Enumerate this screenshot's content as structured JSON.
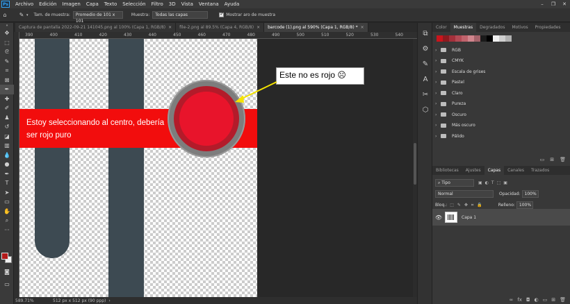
{
  "menubar": {
    "logo": "Ps",
    "items": [
      "Archivo",
      "Edición",
      "Imagen",
      "Capa",
      "Texto",
      "Selección",
      "Filtro",
      "3D",
      "Vista",
      "Ventana",
      "Ayuda"
    ],
    "window_controls": [
      "–",
      "❐",
      "✕"
    ]
  },
  "options_bar": {
    "sample_size_label": "Tam. de muestra:",
    "sample_size_value": "Promedio de 101 x 101",
    "sample_label": "Muestra:",
    "sample_value": "Todas las capas",
    "show_ring_label": "Mostrar aro de muestra"
  },
  "doc_tabs": [
    {
      "label": "Captura de pantalla 2022-09-21 141045.png al 100% (Capa 1, RGB/8)",
      "active": false
    },
    {
      "label": "file-2.png al 89.5% (Capa 4, RGB/8)",
      "active": false
    },
    {
      "label": "barcode (1).png al 590% (Capa 1, RGB/8) *",
      "active": true
    }
  ],
  "ruler": {
    "ticks": [
      "390",
      "400",
      "410",
      "420",
      "430",
      "440",
      "450",
      "460",
      "470",
      "480",
      "490",
      "500",
      "510",
      "520",
      "530",
      "540"
    ]
  },
  "canvas": {
    "annotation_callout": "Este no es rojo ☹",
    "annotation_banner": "Estoy seleccionando al centro, debería ser rojo puro"
  },
  "status": {
    "zoom": "589.71%",
    "doc_info": "512 px x 512 px (90 ppp)"
  },
  "panels": {
    "top_tabs": [
      "Color",
      "Muestras",
      "Degradados",
      "Motivos",
      "Propiedades"
    ],
    "active_top_tab": "Muestras",
    "swatch_colors": [
      "#c9151c",
      "#8e1a1f",
      "#a3303b",
      "#b34a55",
      "#c0636c",
      "#d0858d",
      "#a6636b",
      "#1a1a1a",
      "#000000",
      "#efefef",
      "#cfcfcf",
      "#b0b0b0"
    ],
    "swatch_groups": [
      "RGB",
      "CMYK",
      "Escala de grises",
      "Pastel",
      "Claro",
      "Pureza",
      "Oscuro",
      "Más oscuro",
      "Pálido"
    ],
    "bottom_tabs": [
      "Bibliotecas",
      "Ajustes",
      "Capas",
      "Canales",
      "Trazados"
    ],
    "active_bottom_tab": "Capas",
    "filter_value": "Tipo",
    "blend_mode": "Normal",
    "opacity_label": "Opacidad:",
    "opacity_value": "100%",
    "lock_label": "Bloq.:",
    "fill_label": "Relleno:",
    "fill_value": "100%",
    "layer_name": "Capa 1"
  }
}
